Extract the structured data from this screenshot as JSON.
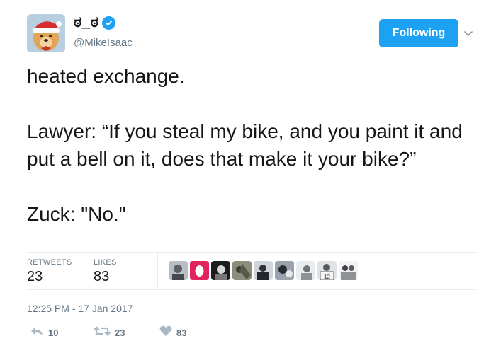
{
  "user": {
    "display_name": "ಠ_ಠ",
    "handle": "@MikeIsaac",
    "verified": true
  },
  "follow_button": {
    "label": "Following"
  },
  "tweet": {
    "paragraphs": [
      "heated exchange.",
      "Lawyer: “If you steal my bike, and you paint it and put a bell on it, does that make it your bike?”",
      "Zuck: \"No.\""
    ],
    "timestamp": "12:25 PM - 17 Jan 2017"
  },
  "stats": {
    "retweets_label": "RETWEETS",
    "retweets_value": "23",
    "likes_label": "LIKES",
    "likes_value": "83"
  },
  "actions": {
    "reply_count": "10",
    "retweet_count": "23",
    "like_count": "83"
  },
  "colors": {
    "accent": "#1da1f2",
    "muted": "#657786",
    "divider": "#e6ecf0"
  },
  "icons": [
    "verified-badge-icon",
    "chevron-down-icon",
    "reply-icon",
    "retweet-icon",
    "heart-icon"
  ]
}
